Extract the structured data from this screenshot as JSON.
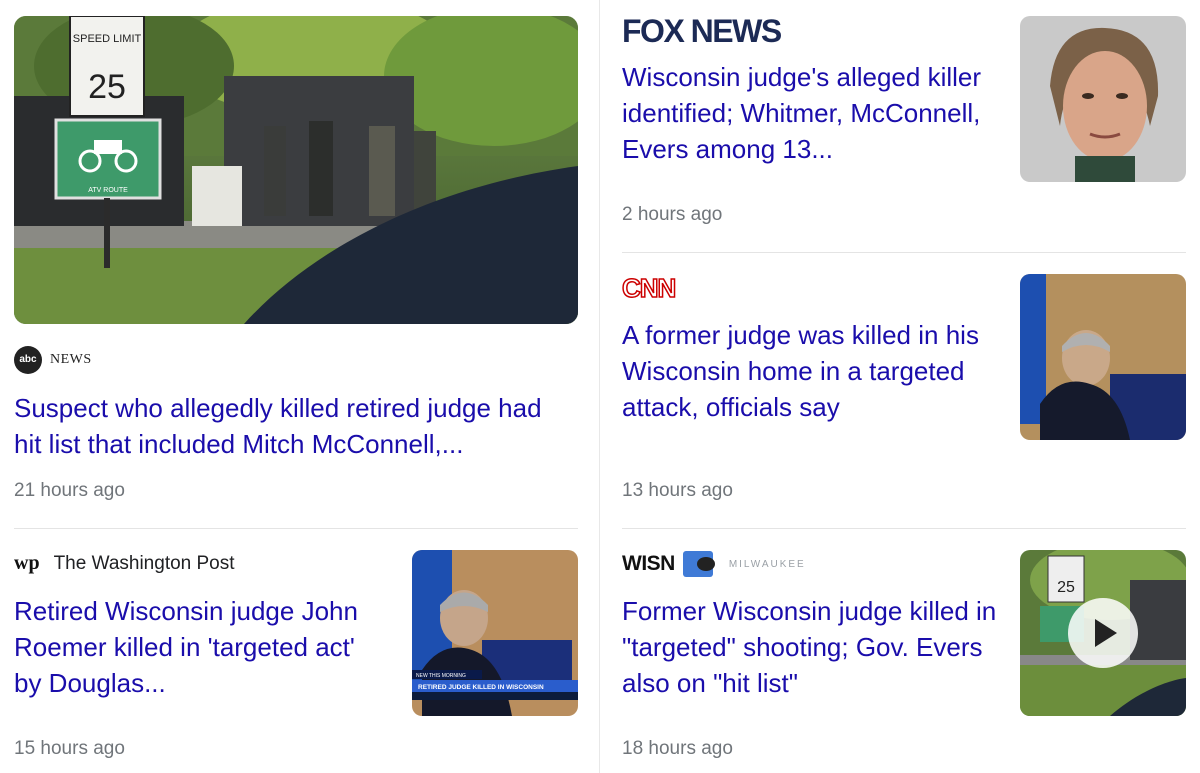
{
  "stories": [
    {
      "source": "NEWS",
      "source_logo": "abc-news-logo",
      "headline": "Suspect who allegedly killed retired judge had hit list that included Mitch McConnell,...",
      "time": "21 hours ago",
      "image_sign_top": "SPEED LIMIT",
      "image_sign_num": "25",
      "image_sign_atv": "ATV ROUTE"
    },
    {
      "source": "FOX NEWS",
      "source_logo": "fox-news-logo",
      "headline": "Wisconsin judge's alleged killer identified; Whitmer, McConnell, Evers among 13...",
      "time": "2 hours ago"
    },
    {
      "source": "CNN",
      "source_logo": "cnn-logo",
      "headline": "A former judge was killed in his Wisconsin home in a targeted attack, officials say",
      "time": "13 hours ago"
    },
    {
      "source": "The Washington Post",
      "source_logo": "wp-logo",
      "source_mark": "wp",
      "headline": "Retired Wisconsin judge John Roemer killed in 'targeted act' by Douglas...",
      "time": "15 hours ago",
      "banner_small": "NEW THIS MORNING",
      "banner_text": "RETIRED JUDGE KILLED IN WISCONSIN"
    },
    {
      "source": "WISN",
      "source_logo": "wisn-logo",
      "source_sub": "MILWAUKEE",
      "headline": "Former Wisconsin judge killed in \"targeted\" shooting; Gov. Evers also on \"hit list\"",
      "time": "18 hours ago"
    }
  ],
  "colors": {
    "headline": "#1a0dab",
    "time": "#70757a",
    "fox": "#1c2a55",
    "cnn": "#cc0000"
  }
}
